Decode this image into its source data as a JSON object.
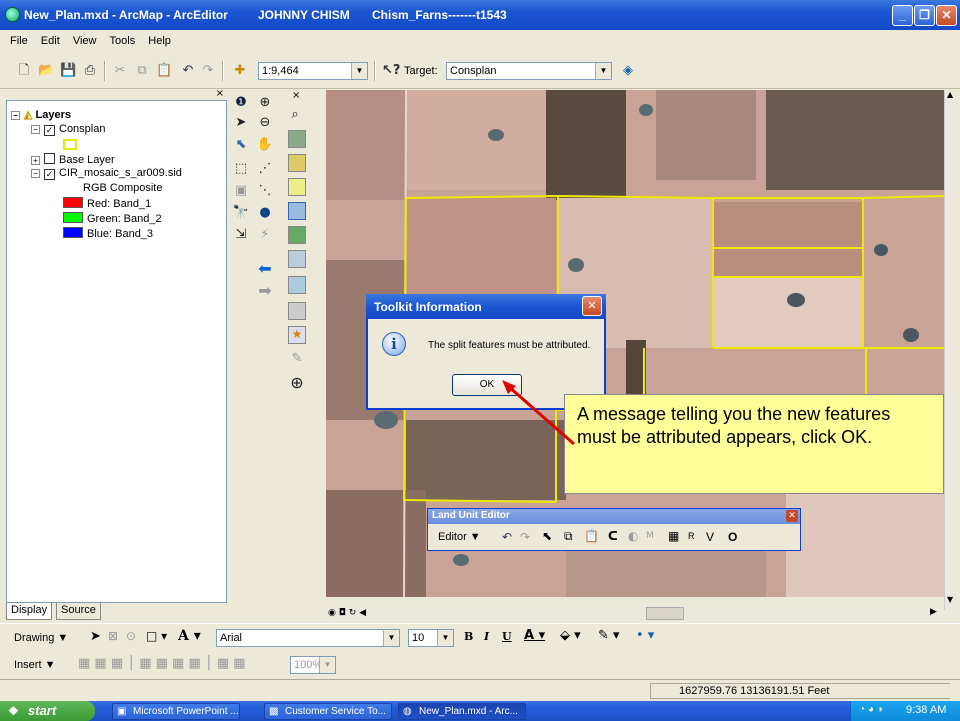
{
  "window": {
    "title": "New_Plan.mxd - ArcMap - ArcEditor",
    "user": "JOHNNY CHISM",
    "project": "Chism_Farns-------t1543"
  },
  "menu": [
    "File",
    "Edit",
    "View",
    "Tools",
    "Help"
  ],
  "toolbar": {
    "scale": "1:9,464",
    "target_label": "Target:",
    "target_value": "Consplan"
  },
  "toc": {
    "root": "Layers",
    "items": [
      {
        "label": "Consplan"
      },
      {
        "label": "Base Layer"
      },
      {
        "label": "CIR_mosaic_s_ar009.sid"
      },
      {
        "label": "RGB Composite"
      },
      {
        "label": "Red:   Band_1",
        "color": "#ff0000"
      },
      {
        "label": "Green: Band_2",
        "color": "#00ff00"
      },
      {
        "label": "Blue:   Band_3",
        "color": "#0000ff"
      }
    ],
    "tabs": [
      "Display",
      "Source"
    ]
  },
  "dialog": {
    "title": "Toolkit Information",
    "message": "The split features must be attributed.",
    "ok_label": "OK"
  },
  "callout": {
    "text": "A message telling you the new features must be attributed appears, click OK."
  },
  "land_unit_editor": {
    "title": "Land Unit Editor",
    "editor_label": "Editor ▼",
    "letters": [
      "R",
      "V",
      "O"
    ]
  },
  "drawing": {
    "drawing_label": "Drawing ▼",
    "font": "Arial",
    "size": "10",
    "insert_label": "Insert ▼",
    "zoom": "100%"
  },
  "status": {
    "coords": "1627959.76  13136191.51 Feet"
  },
  "taskbar": {
    "start": "start",
    "tasks": [
      "Microsoft PowerPoint ...",
      "Customer Service To...",
      "New_Plan.mxd - Arc..."
    ],
    "time": "9:38 AM"
  }
}
